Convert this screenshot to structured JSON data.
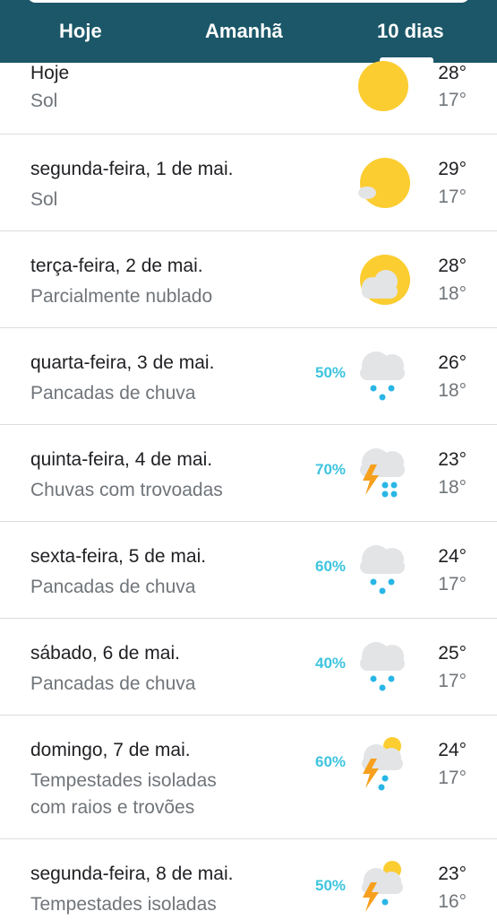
{
  "tabs": [
    {
      "label": "Hoje"
    },
    {
      "label": "Amanhã"
    },
    {
      "label": "10 dias"
    }
  ],
  "forecast": [
    {
      "day": "Hoje",
      "condition": "Sol",
      "precip": "",
      "high": "28°",
      "low": "17°",
      "icon": "sun-icon"
    },
    {
      "day": "segunda-feira, 1 de mai.",
      "condition": "Sol",
      "precip": "",
      "high": "29°",
      "low": "17°",
      "icon": "sun-icon"
    },
    {
      "day": "terça-feira, 2 de mai.",
      "condition": "Parcialmente nublado",
      "precip": "",
      "high": "28°",
      "low": "18°",
      "icon": "partly-cloudy-icon"
    },
    {
      "day": "quarta-feira, 3 de mai.",
      "condition": "Pancadas de chuva",
      "precip": "50%",
      "high": "26°",
      "low": "18°",
      "icon": "rain-icon"
    },
    {
      "day": "quinta-feira, 4 de mai.",
      "condition": "Chuvas com trovoadas",
      "precip": "70%",
      "high": "23°",
      "low": "18°",
      "icon": "thunderstorm-icon"
    },
    {
      "day": "sexta-feira, 5 de mai.",
      "condition": "Pancadas de chuva",
      "precip": "60%",
      "high": "24°",
      "low": "17°",
      "icon": "rain-icon"
    },
    {
      "day": "sábado, 6 de mai.",
      "condition": "Pancadas de chuva",
      "precip": "40%",
      "high": "25°",
      "low": "17°",
      "icon": "rain-icon"
    },
    {
      "day": "domingo, 7 de mai.",
      "condition": "Tempestades isoladas",
      "condition2": "com raios e trovões",
      "precip": "60%",
      "high": "24°",
      "low": "17°",
      "icon": "isolated-storm-icon"
    },
    {
      "day": "segunda-feira, 8 de mai.",
      "condition": "Tempestades isoladas",
      "precip": "50%",
      "high": "23°",
      "low": "16°",
      "icon": "isolated-storm-icon"
    }
  ],
  "colors": {
    "header": "#1b5768",
    "precip": "#3ec4df",
    "sun": "#fbcd31",
    "cloud": "#e3e4e6",
    "rain": "#29b6e6",
    "bolt": "#f7a01d"
  }
}
